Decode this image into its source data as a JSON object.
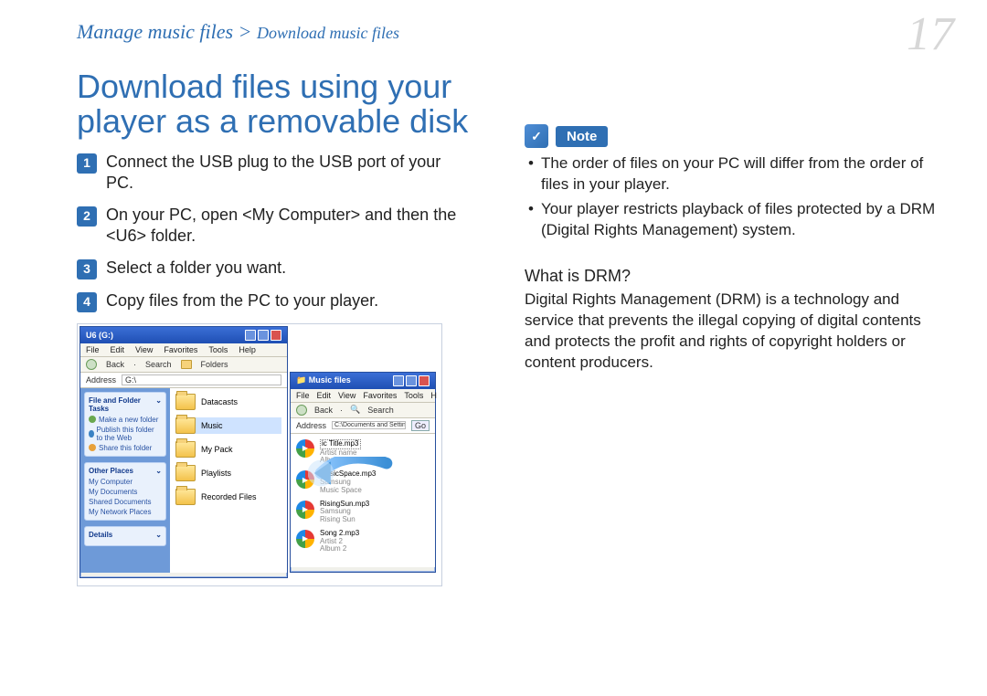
{
  "header": {
    "breadcrumb_main": "Manage music files",
    "breadcrumb_sep": " > ",
    "breadcrumb_sub": "Download music files",
    "page_number": "17"
  },
  "left": {
    "title": "Download files using your player as a removable disk",
    "steps": [
      "Connect the USB plug to the USB port of your PC.",
      "On your PC, open <My Computer> and then the <U6> folder.",
      "Select a folder you want.",
      "Copy files from the PC to your player."
    ],
    "screenshot": {
      "win1": {
        "title": "U6 (G:)",
        "menus": [
          "File",
          "Edit",
          "View",
          "Favorites",
          "Tools",
          "Help"
        ],
        "toolbar": {
          "back": "Back",
          "search": "Search",
          "folders": "Folders"
        },
        "address_label": "Address",
        "address_value": "G:\\",
        "side_tasks": {
          "header": "File and Folder Tasks",
          "items": [
            "Make a new folder",
            "Publish this folder to the Web",
            "Share this folder"
          ]
        },
        "side_places": {
          "header": "Other Places",
          "items": [
            "My Computer",
            "My Documents",
            "Shared Documents",
            "My Network Places"
          ]
        },
        "side_details": {
          "header": "Details"
        },
        "folders": [
          "Datacasts",
          "Music",
          "My Pack",
          "Playlists",
          "Recorded Files"
        ],
        "selected_folder": "Music"
      },
      "win2": {
        "title": "Music files",
        "menus": [
          "File",
          "Edit",
          "View",
          "Favorites",
          "Tools",
          "H"
        ],
        "toolbar": {
          "back": "Back",
          "search": "Search"
        },
        "address_label": "Address",
        "address_value": "C:\\Documents and Settings\\",
        "go": "Go",
        "files": [
          {
            "name": "ic Title.mp3",
            "line2": "Artist name",
            "line3": "Album name"
          },
          {
            "name": "MusicSpace.mp3",
            "line2": "Samsung",
            "line3": "Music Space"
          },
          {
            "name": "RisingSun.mp3",
            "line2": "Samsung",
            "line3": "Rising Sun"
          },
          {
            "name": "Song 2.mp3",
            "line2": "Artist 2",
            "line3": "Album 2"
          }
        ]
      }
    }
  },
  "right": {
    "note_label": "Note",
    "note_items": [
      "The order of files on your PC will differ from the order of files in your player.",
      "Your player restricts playback of files protected by a DRM (Digital Rights Management) system."
    ],
    "drm": {
      "heading": "What is DRM?",
      "body": "Digital Rights Management (DRM) is a technology and service that prevents the illegal copying of digital contents and protects the profit and rights of copyright holders or content producers."
    }
  }
}
